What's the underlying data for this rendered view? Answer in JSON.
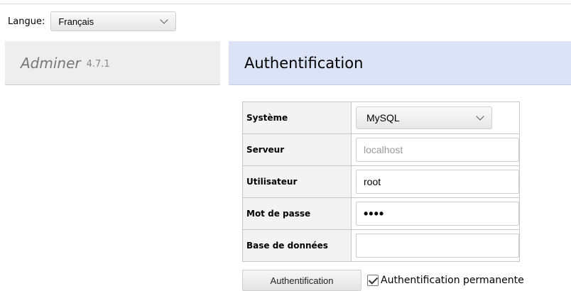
{
  "language": {
    "label": "Langue:",
    "selected": "Français"
  },
  "menu": {
    "name": "Adminer",
    "version": "4.7.1"
  },
  "content": {
    "title": "Authentification"
  },
  "form": {
    "rows": [
      {
        "label": "Système",
        "value": "MySQL"
      },
      {
        "label": "Serveur",
        "placeholder": "localhost",
        "value": ""
      },
      {
        "label": "Utilisateur",
        "value": "root"
      },
      {
        "label": "Mot de passe",
        "value": "••••"
      },
      {
        "label": "Base de données",
        "value": ""
      }
    ],
    "submit_label": "Authentification",
    "permanent_label": "Authentification permanente",
    "permanent_checked": true
  }
}
